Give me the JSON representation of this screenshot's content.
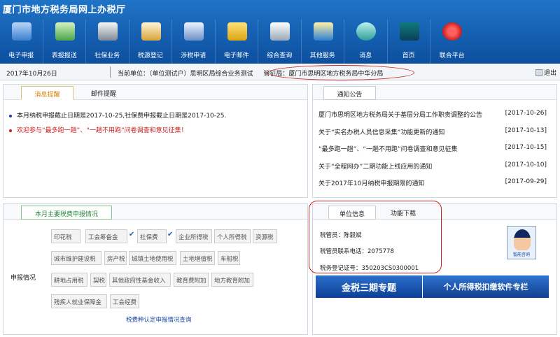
{
  "app": {
    "title": "厦门市地方税务局网上办税厅"
  },
  "nav": [
    {
      "label": "电子申报",
      "icon": "monitor-icon"
    },
    {
      "label": "表报报送",
      "icon": "upload-arrow-icon"
    },
    {
      "label": "社保业务",
      "icon": "gears-icon"
    },
    {
      "label": "税源登记",
      "icon": "register-pencil-icon"
    },
    {
      "label": "涉税申请",
      "icon": "documents-icon"
    },
    {
      "label": "电子邮件",
      "icon": "envelope-icon"
    },
    {
      "label": "综合查询",
      "icon": "magnifier-icon"
    },
    {
      "label": "其他服务",
      "icon": "magic-wand-icon"
    },
    {
      "label": "消息",
      "icon": "speech-bubble-icon"
    },
    {
      "label": "首页",
      "icon": "home-book-icon"
    },
    {
      "label": "联合平台",
      "icon": "emblem-icon"
    }
  ],
  "infobar": {
    "date": "2017年10月26日",
    "unit": "当前单位：（单位测试户）思明区局综合业务测试",
    "authority": "管征局：厦门市思明区地方税务局中华分局",
    "exit": "退出"
  },
  "messages_panel": {
    "tabs": [
      {
        "label": "消息提醒",
        "active": true
      },
      {
        "label": "邮件提醒",
        "active": false
      }
    ],
    "items": [
      {
        "text": "本月纳税申报截止日期是2017-10-25,社保费申报截止日期是2017-10-25.",
        "color": "#1a1a1a",
        "bullet": "#1d3fa5"
      },
      {
        "text": "欢迎参与“最多跑一趟”、“一趟不用跑”问卷调查和意见征集！",
        "color": "#c81e1e",
        "bullet": "#c81e1e"
      }
    ]
  },
  "notice_panel": {
    "tab": "通知公告",
    "items": [
      {
        "title": "厦门市思明区地方税务局关于基层分局工作职责调整的公告",
        "date": "[2017-10-26]"
      },
      {
        "title": "关于“实名办税人员信息采集”功能更新的通知",
        "date": "[2017-10-13]"
      },
      {
        "title": "“最多跑一趟”、“一趟不用跑”问卷调查和意见征集",
        "date": "[2017-10-15]"
      },
      {
        "title": "关于“全程网办”二期功能上线应用的通知",
        "date": "[2017-10-10]"
      },
      {
        "title": "关于2017年10月纳税申报期限的通知",
        "date": "[2017-09-29]"
      }
    ]
  },
  "report_panel": {
    "tab": "本月主要税费申报情况",
    "label": "申报情况",
    "rows": [
      [
        {
          "name": "印花税",
          "checked": false
        },
        {
          "name": "工会筹备金",
          "checked": true
        },
        {
          "name": "社保费",
          "checked": true
        },
        {
          "name": "企业所得税",
          "checked": false
        },
        {
          "name": "个人所得税",
          "checked": false
        },
        {
          "name": "资源税",
          "checked": false
        }
      ],
      [
        {
          "name": "城市维护建设税",
          "checked": false
        },
        {
          "name": "房产税",
          "checked": false
        },
        {
          "name": "城镇土地使用税",
          "checked": false
        },
        {
          "name": "土地增值税",
          "checked": false
        },
        {
          "name": "车船税",
          "checked": false
        }
      ],
      [
        {
          "name": "耕地占用税",
          "checked": false
        },
        {
          "name": "契税",
          "checked": false
        },
        {
          "name": "其他政府性基金收入",
          "checked": false
        },
        {
          "name": "教育费附加",
          "checked": false
        },
        {
          "name": "地方教育附加",
          "checked": false
        }
      ],
      [
        {
          "name": "残疾人就业保障金",
          "checked": false
        },
        {
          "name": "工会经费",
          "checked": false
        }
      ]
    ],
    "link": "税费种认定申报情况查询"
  },
  "unit_panel": {
    "tabs": [
      {
        "label": "单位信息",
        "active": true
      },
      {
        "label": "功能下载",
        "active": false
      }
    ],
    "lines": [
      "税管员：陈毅斌",
      "税管员联系电话：2075778",
      "税务登记证号：350203CS0300001"
    ],
    "avatar_label": "智能咨询"
  },
  "banners": [
    "金税三期专题",
    "个人所得税扣缴软件专栏"
  ],
  "colors": {
    "header": "#125aa9",
    "accent_orange": "#d98200",
    "danger": "#c81e1e",
    "link_blue": "#1a46a3"
  }
}
